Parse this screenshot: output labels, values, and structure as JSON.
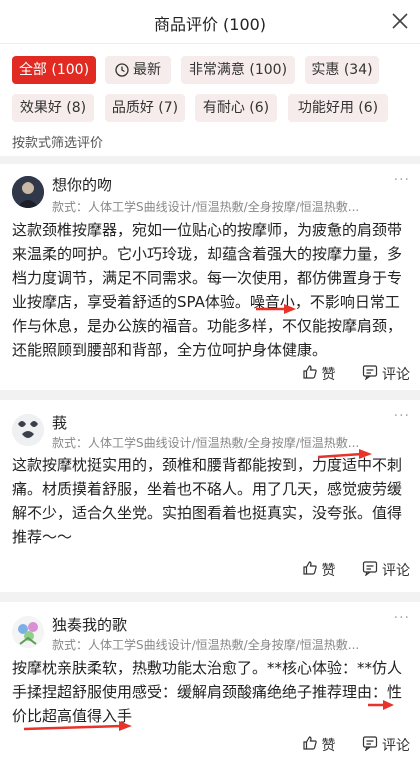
{
  "header": {
    "title": "商品评价 (100)",
    "close_icon": "close-icon"
  },
  "filters": {
    "chips": [
      {
        "label": "全部 (100)",
        "active": true
      },
      {
        "label": "最新",
        "icon": "clock-icon"
      },
      {
        "label": "非常满意 (100)"
      },
      {
        "label": "实惠 (34)"
      },
      {
        "label": "效果好 (8)"
      },
      {
        "label": "品质好 (7)"
      },
      {
        "label": "有耐心 (6)"
      },
      {
        "label": "功能好用 (6)"
      }
    ],
    "style_filter": "按款式筛选评价"
  },
  "reviews": [
    {
      "user": "想你的吻",
      "spec": "款式：人体工学S曲线设计/恒温热敷/全身按摩/恒温热敷...",
      "body": "这款颈椎按摩器，宛如一位贴心的按摩师，为疲惫的肩颈带来温柔的呵护。它小巧玲珑，却蕴含着强大的按摩力量，多档力度调节，满足不同需求。每一次使用，都仿佛置身于专业按摩店，享受着舒适的SPA体验。噪音小，不影响日常工作与休息，是办公族的福音。功能多样，不仅能按摩肩颈，还能照顾到腰部和背部，全方位呵护身体健康。",
      "like": "赞",
      "comment": "评论"
    },
    {
      "user": "莪",
      "spec": "款式：人体工学S曲线设计/恒温热敷/全身按摩/恒温热敷...",
      "body": "这款按摩枕挺实用的，颈椎和腰背都能按到，力度适中不刺痛。材质摸着舒服，坐着也不硌人。用了几天，感觉疲劳缓解不少，适合久坐党。实拍图看着也挺真实，没夸张。值得推荐～～",
      "like": "赞",
      "comment": "评论"
    },
    {
      "user": "独奏我的歌",
      "spec": "款式：人体工学S曲线设计/恒温热敷/全身按摩/恒温热敷...",
      "body": "按摩枕亲肤柔软，热敷功能太治愈了。**核心体验：**仿人手揉捏超舒服使用感受：缓解肩颈酸痛绝绝子推荐理由：性价比超高值得入手",
      "like": "赞",
      "comment": "评论"
    }
  ],
  "colors": {
    "accent": "#e02a22",
    "chip_bg": "#f7ecec",
    "annotation_arrow": "#e8332b"
  }
}
